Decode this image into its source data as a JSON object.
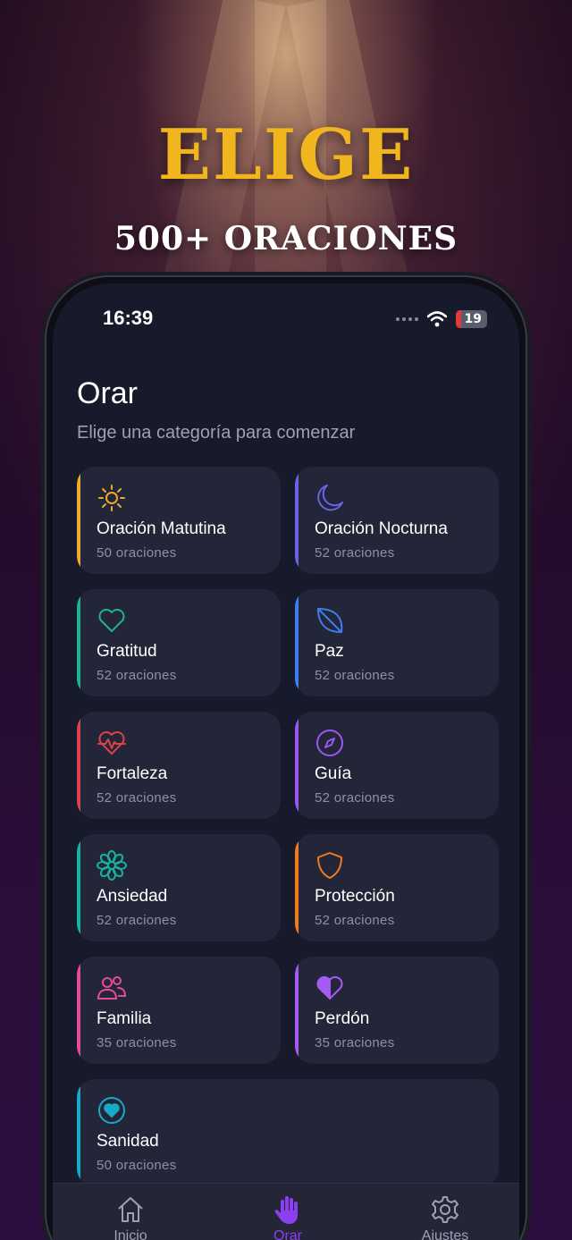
{
  "hero": {
    "title": "ELIGE",
    "subtitle": "500+ ORACIONES"
  },
  "status": {
    "time": "16:39",
    "battery": "19"
  },
  "header": {
    "title": "Orar",
    "subtitle": "Elige una categoría para comenzar"
  },
  "categories": [
    {
      "name": "Oración Matutina",
      "count": "50 oraciones",
      "color": "#f0a92a",
      "icon": "sun-icon"
    },
    {
      "name": "Oración Nocturna",
      "count": "52 oraciones",
      "color": "#6b63e6",
      "icon": "moon-icon"
    },
    {
      "name": "Gratitud",
      "count": "52 oraciones",
      "color": "#1fb38c",
      "icon": "heart-icon"
    },
    {
      "name": "Paz",
      "count": "52 oraciones",
      "color": "#3d7ff0",
      "icon": "leaf-icon"
    },
    {
      "name": "Fortaleza",
      "count": "52 oraciones",
      "color": "#e0404a",
      "icon": "heartbeat-icon"
    },
    {
      "name": "Guía",
      "count": "52 oraciones",
      "color": "#9b57f0",
      "icon": "compass-icon"
    },
    {
      "name": "Ansiedad",
      "count": "52 oraciones",
      "color": "#18b3a0",
      "icon": "flower-icon"
    },
    {
      "name": "Protección",
      "count": "52 oraciones",
      "color": "#f07a1e",
      "icon": "shield-icon"
    },
    {
      "name": "Familia",
      "count": "35 oraciones",
      "color": "#e84a9a",
      "icon": "users-icon"
    },
    {
      "name": "Perdón",
      "count": "35 oraciones",
      "color": "#a35bf2",
      "icon": "half-heart-icon"
    },
    {
      "name": "Sanidad",
      "count": "50 oraciones",
      "color": "#19a8c8",
      "icon": "heart-circle-icon"
    }
  ],
  "tabs": [
    {
      "label": "Inicio",
      "icon": "home-icon",
      "color": "#9ea1b4"
    },
    {
      "label": "Orar",
      "icon": "hand-icon",
      "color": "#8b3ff0"
    },
    {
      "label": "Ajustes",
      "icon": "gear-icon",
      "color": "#9ea1b4"
    }
  ]
}
